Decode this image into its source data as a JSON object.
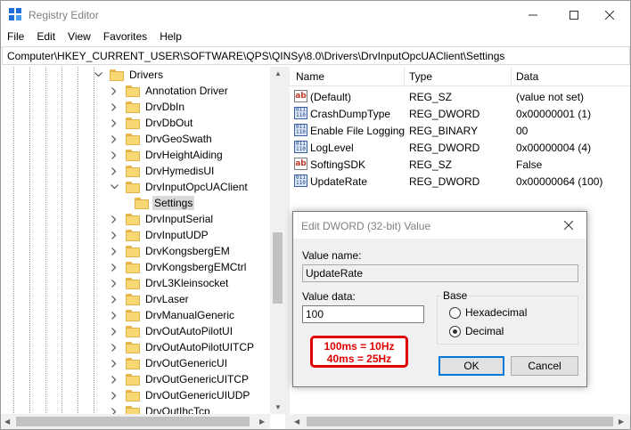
{
  "window": {
    "title": "Registry Editor",
    "controls": {
      "minimize": "—",
      "maximize": "☐",
      "close": "✕"
    }
  },
  "menu": [
    "File",
    "Edit",
    "View",
    "Favorites",
    "Help"
  ],
  "address": "Computer\\HKEY_CURRENT_USER\\SOFTWARE\\QPS\\QINSy\\8.0\\Drivers\\DrvInputOpcUAClient\\Settings",
  "tree": {
    "parent": "Drivers",
    "items": [
      "Annotation Driver",
      "DrvDbIn",
      "DrvDbOut",
      "DrvGeoSwath",
      "DrvHeightAiding",
      "DrvHymedisUI",
      "DrvInputOpcUAClient",
      "Settings",
      "DrvInputSerial",
      "DrvInputUDP",
      "DrvKongsbergEM",
      "DrvKongsbergEMCtrl",
      "DrvL3Kleinsocket",
      "DrvLaser",
      "DrvManualGeneric",
      "DrvOutAutoPilotUI",
      "DrvOutAutoPilotUITCP",
      "DrvOutGenericUI",
      "DrvOutGenericUITCP",
      "DrvOutGenericUIUDP",
      "DrvOutIhcTcp"
    ]
  },
  "list": {
    "headers": {
      "name": "Name",
      "type": "Type",
      "data": "Data"
    },
    "rows": [
      {
        "name": "(Default)",
        "type": "REG_SZ",
        "data": "(value not set)",
        "icon": "string-value-icon"
      },
      {
        "name": "CrashDumpType",
        "type": "REG_DWORD",
        "data": "0x00000001 (1)",
        "icon": "binary-value-icon"
      },
      {
        "name": "Enable File Logging",
        "type": "REG_BINARY",
        "data": "00",
        "icon": "binary-value-icon"
      },
      {
        "name": "LogLevel",
        "type": "REG_DWORD",
        "data": "0x00000004 (4)",
        "icon": "binary-value-icon"
      },
      {
        "name": "SoftingSDK",
        "type": "REG_SZ",
        "data": "False",
        "icon": "string-value-icon"
      },
      {
        "name": "UpdateRate",
        "type": "REG_DWORD",
        "data": "0x00000064 (100)",
        "icon": "binary-value-icon"
      }
    ]
  },
  "dialog": {
    "title": "Edit DWORD (32-bit) Value",
    "value_name_label": "Value name:",
    "value_name": "UpdateRate",
    "value_data_label": "Value data:",
    "value_data": "100",
    "base_label": "Base",
    "hex_label": "Hexadecimal",
    "dec_label": "Decimal",
    "ok": "OK",
    "cancel": "Cancel",
    "close": "✕"
  },
  "annotation": {
    "line1": "100ms = 10Hz",
    "line2": "40ms = 25Hz",
    "color": "#e00000"
  }
}
